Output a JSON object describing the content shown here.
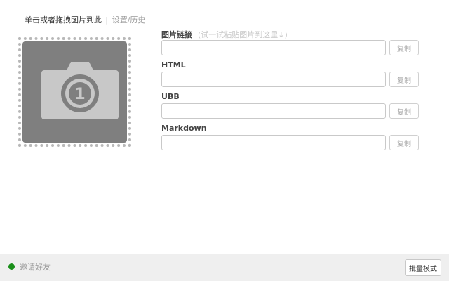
{
  "header": {
    "upload_text": "单击或者拖拽图片到此",
    "separator": "|",
    "settings_text": "设置/历史"
  },
  "drop_zone": {
    "badge_number": "1"
  },
  "fields": [
    {
      "label": "图片链接",
      "hint": "(试一试粘贴图片到这里↓)",
      "value": "",
      "copy_label": "复制"
    },
    {
      "label": "HTML",
      "hint": "",
      "value": "",
      "copy_label": "复制"
    },
    {
      "label": "UBB",
      "hint": "",
      "value": "",
      "copy_label": "复制"
    },
    {
      "label": "Markdown",
      "hint": "",
      "value": "",
      "copy_label": "复制"
    }
  ],
  "footer": {
    "invite_text": "邀请好友",
    "batch_label": "批量模式",
    "status_color": "#1a8f1a"
  }
}
